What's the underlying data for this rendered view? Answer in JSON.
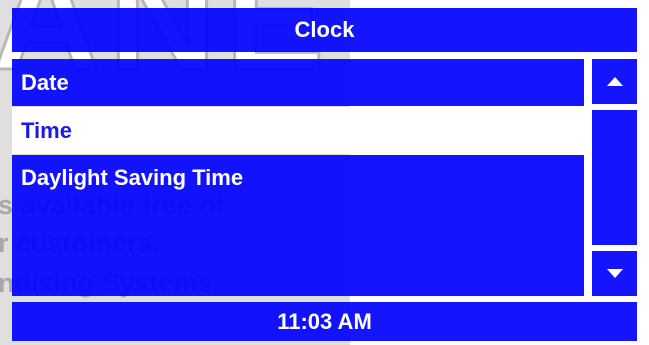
{
  "window": {
    "title": "Clock"
  },
  "menu": {
    "items": [
      {
        "label": "Date",
        "selected": false
      },
      {
        "label": "Time",
        "selected": true
      },
      {
        "label": "Daylight Saving Time",
        "selected": false
      }
    ]
  },
  "scrollbar": {
    "up_icon": "triangle-up-icon",
    "down_icon": "triangle-down-icon"
  },
  "footer": {
    "time": "11:03 AM"
  },
  "watermark": {
    "logo_text": "ANE",
    "lines": [
      "s available free of",
      "r customers.",
      "ndising Systems"
    ]
  },
  "colors": {
    "panel_blue": "#0000ff",
    "text_white": "#ffffff",
    "selected_bg": "#ffffff",
    "selected_text": "#1a1ae6",
    "watermark_gray": "#b8b8b8"
  }
}
